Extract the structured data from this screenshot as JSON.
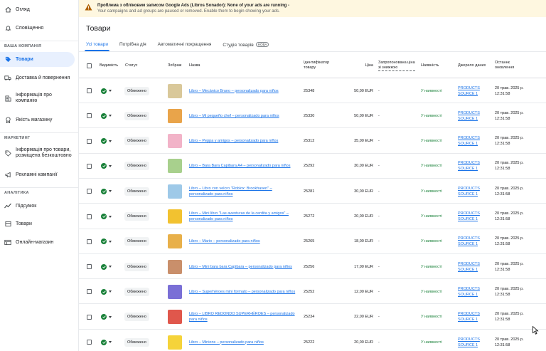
{
  "sidebar": {
    "items": [
      {
        "label": "Огляд",
        "icon": "home-icon",
        "y": 6
      },
      {
        "label": "Сповіщення",
        "icon": "bell-icon",
        "y": 32
      }
    ],
    "section_campaign": "ВАША КОМПАНІЯ",
    "campaign_items": [
      {
        "label": "Товари",
        "icon": "tag-icon",
        "active": true
      },
      {
        "label": "Доставка й повернення",
        "icon": "truck-icon"
      },
      {
        "label": "Інформація про компанію",
        "icon": "building-icon"
      },
      {
        "label": "Якість магазину",
        "icon": "quality-icon"
      }
    ],
    "section_marketing": "МАРКЕТИНГ",
    "marketing_items": [
      {
        "label": "Інформація про товари, розміщена безкоштовно",
        "icon": "tag-outline-icon"
      },
      {
        "label": "Рекламні кампанії",
        "icon": "megaphone-icon"
      }
    ],
    "section_analytics": "АНАЛІТИКА",
    "analytics_items": [
      {
        "label": "Підсумок",
        "icon": "trend-icon"
      },
      {
        "label": "Товари",
        "icon": "box-icon"
      },
      {
        "label": "Онлайн-магазин",
        "icon": "storefront-icon"
      }
    ]
  },
  "banner": {
    "title": "Проблема з обліковим записом Google Ads (Libros Sonador): None of your ads are running -",
    "subtitle": "Your campaigns and ad groups are paused or removed. Enable them to begin showing your ads."
  },
  "page_title": "Товари",
  "tabs": [
    {
      "label": "Усі товари",
      "active": true
    },
    {
      "label": "Потрібна дія"
    },
    {
      "label": "Автоматичні покращення"
    },
    {
      "label": "Студія товарів",
      "badge": "НОВА"
    }
  ],
  "columns": {
    "visible": "Видимість",
    "status": "Статус",
    "image": "Зображ",
    "name": "Назва",
    "id": "Ідентифікатор товару",
    "price": "Ціна",
    "suggested": "Запропонована ціна зі знижкою",
    "availability": "Наявність",
    "source": "Джерело даних",
    "updated": "Останнє оновлення"
  },
  "colors": {
    "accent": "#1a73e8",
    "green": "#188038",
    "banner_bg": "#fef7e0"
  },
  "rows": [
    {
      "status": "Обмежено",
      "name": "Libro – Mecánico Bruno – personalizado para niños",
      "id": "25348",
      "price": "50,00 EUR",
      "suggested": "-",
      "availability": "У наявності",
      "source": "PRODUCTS SOURCE 1",
      "updated": "20 трав. 2025 р. 12:31:58",
      "thumb": "#d9c89a"
    },
    {
      "status": "Обмежено",
      "name": "Libro – Mi pequeño chef – personalizado para niños",
      "id": "25330",
      "price": "50,00 EUR",
      "suggested": "-",
      "availability": "У наявності",
      "source": "PRODUCTS SOURCE 1",
      "updated": "20 трав. 2025 р. 12:31:58",
      "thumb": "#e9a44a"
    },
    {
      "status": "Обмежено",
      "name": "Libro – Peppa y amigos – personalizado para niños",
      "id": "25312",
      "price": "35,00 EUR",
      "suggested": "-",
      "availability": "У наявності",
      "source": "PRODUCTS SOURCE 1",
      "updated": "20 трав. 2025 р. 12:31:58",
      "thumb": "#f2b3c8"
    },
    {
      "status": "Обмежено",
      "name": "Libro – Bara Bara Capibara A4 – personalizado para niños",
      "id": "25292",
      "price": "30,00 EUR",
      "suggested": "-",
      "availability": "У наявності",
      "source": "PRODUCTS SOURCE 1",
      "updated": "20 трав. 2025 р. 12:31:58",
      "thumb": "#a8d08d"
    },
    {
      "status": "Обмежено",
      "name": "Libro – Libro con velcro \"Roblox: Brookhaven\" – personalizado para niños",
      "id": "25281",
      "price": "30,00 EUR",
      "suggested": "-",
      "availability": "У наявності",
      "source": "PRODUCTS SOURCE 1",
      "updated": "20 трав. 2025 р. 12:31:58",
      "thumb": "#9ec9e8"
    },
    {
      "status": "Обмежено",
      "name": "Libro – Mini libro \"Las aventuras de la cerdita y amigos\" – personalizado para niños",
      "id": "25272",
      "price": "20,00 EUR",
      "suggested": "-",
      "availability": "У наявності",
      "source": "PRODUCTS SOURCE 1",
      "updated": "20 трав. 2025 р. 12:31:58",
      "thumb": "#f2c230"
    },
    {
      "status": "Обмежено",
      "name": "Libro – Mario – personalizado para niños",
      "id": "25265",
      "price": "18,00 EUR",
      "suggested": "-",
      "availability": "У наявності",
      "source": "PRODUCTS SOURCE 1",
      "updated": "20 трав. 2025 р. 12:31:58",
      "thumb": "#e8b04a"
    },
    {
      "status": "Обмежено",
      "name": "Libro – Mini bara bara Capibara – personalizado para niños",
      "id": "25256",
      "price": "17,00 EUR",
      "suggested": "-",
      "availability": "У наявності",
      "source": "PRODUCTS SOURCE 1",
      "updated": "20 трав. 2025 р. 12:31:58",
      "thumb": "#c98f6b"
    },
    {
      "status": "Обмежено",
      "name": "Libro – Superhéroes mini formato – personalizado para niños",
      "id": "25252",
      "price": "12,00 EUR",
      "suggested": "-",
      "availability": "У наявності",
      "source": "PRODUCTS SOURCE 1",
      "updated": "20 трав. 2025 р. 12:31:58",
      "thumb": "#7a6fd6"
    },
    {
      "status": "Обмежено",
      "name": "Libro – LIBRO REDONDO SUPERHÉROES – personalizado para niños",
      "id": "25234",
      "price": "22,00 EUR",
      "suggested": "-",
      "availability": "У наявності",
      "source": "PRODUCTS SOURCE 1",
      "updated": "20 трав. 2025 р. 12:31:58",
      "thumb": "#e0574c"
    },
    {
      "status": "Обмежено",
      "name": "Libro – Minions – personalizado para niños",
      "id": "25222",
      "price": "20,00 EUR",
      "suggested": "-",
      "availability": "У наявності",
      "source": "PRODUCTS SOURCE 1",
      "updated": "20 трав. 2025 р. 12:31:58",
      "thumb": "#f5d33a"
    }
  ]
}
